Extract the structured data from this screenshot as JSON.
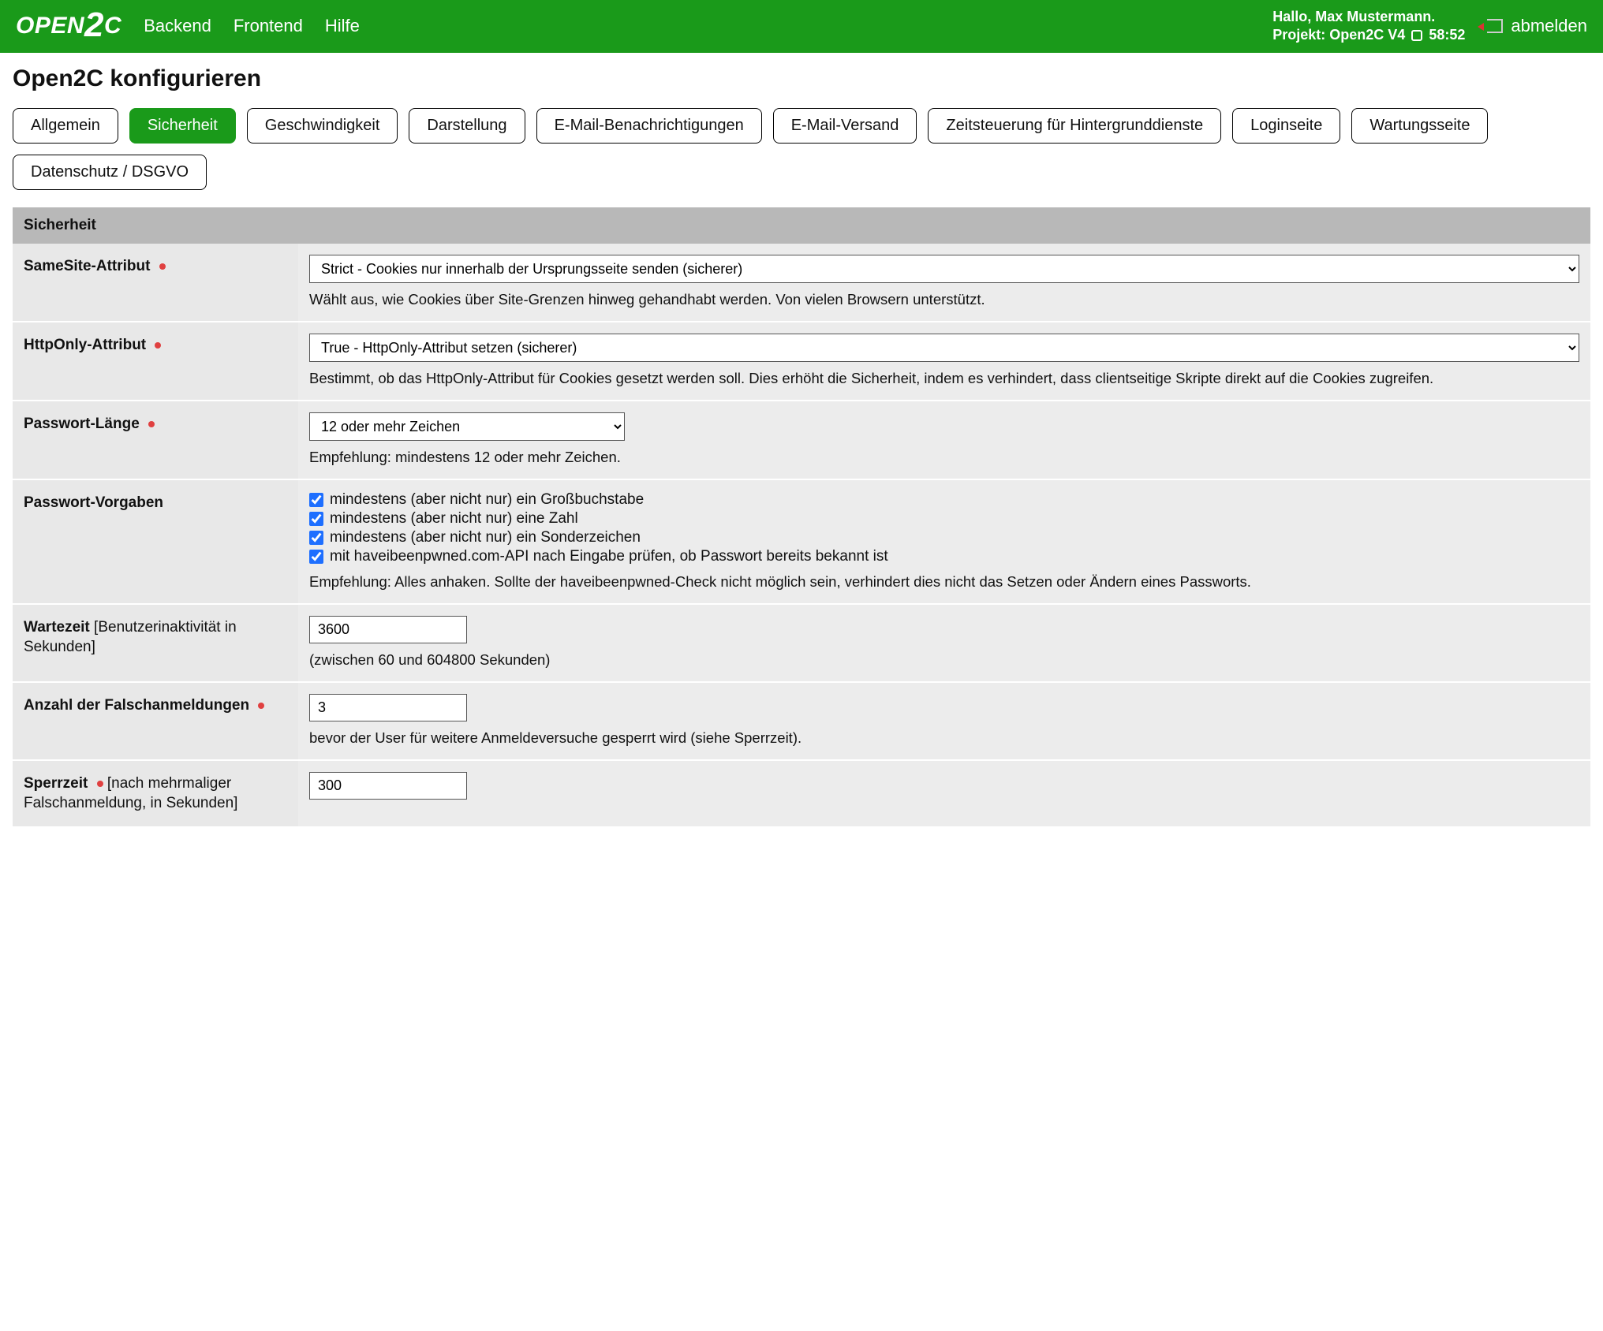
{
  "header": {
    "logo_prefix": "OPEN",
    "logo_big": "2",
    "logo_suffix": "C",
    "nav": [
      "Backend",
      "Frontend",
      "Hilfe"
    ],
    "greeting": "Hallo, Max Mustermann.",
    "project_label": "Projekt: Open2C V4",
    "timer": "58:52",
    "logout": "abmelden"
  },
  "page_title": "Open2C konfigurieren",
  "tabs": [
    {
      "label": "Allgemein",
      "active": false
    },
    {
      "label": "Sicherheit",
      "active": true
    },
    {
      "label": "Geschwindigkeit",
      "active": false
    },
    {
      "label": "Darstellung",
      "active": false
    },
    {
      "label": "E-Mail-Benachrichtigungen",
      "active": false
    },
    {
      "label": "E-Mail-Versand",
      "active": false
    },
    {
      "label": "Zeitsteuerung für Hintergrunddienste",
      "active": false
    },
    {
      "label": "Loginseite",
      "active": false
    },
    {
      "label": "Wartungsseite",
      "active": false
    },
    {
      "label": "Datenschutz / DSGVO",
      "active": false
    }
  ],
  "section_title": "Sicherheit",
  "rows": {
    "samesite": {
      "label": "SameSite-Attribut",
      "required": true,
      "value": "Strict - Cookies nur innerhalb der Ursprungsseite senden (sicherer)",
      "help": "Wählt aus, wie Cookies über Site-Grenzen hinweg gehandhabt werden. Von vielen Browsern unterstützt."
    },
    "httponly": {
      "label": "HttpOnly-Attribut",
      "required": true,
      "value": "True - HttpOnly-Attribut setzen (sicherer)",
      "help": "Bestimmt, ob das HttpOnly-Attribut für Cookies gesetzt werden soll. Dies erhöht die Sicherheit, indem es verhindert, dass clientseitige Skripte direkt auf die Cookies zugreifen."
    },
    "pwlen": {
      "label": "Passwort-Länge",
      "required": true,
      "value": "12 oder mehr Zeichen",
      "help": "Empfehlung: mindestens 12 oder mehr Zeichen."
    },
    "pwrules": {
      "label": "Passwort-Vorgaben",
      "required": false,
      "options": [
        "mindestens (aber nicht nur) ein Großbuchstabe",
        "mindestens (aber nicht nur) eine Zahl",
        "mindestens (aber nicht nur) ein Sonderzeichen",
        "mit haveibeenpwned.com-API nach Eingabe prüfen, ob Passwort bereits bekannt ist"
      ],
      "help": "Empfehlung: Alles anhaken. Sollte der haveibeenpwned-Check nicht möglich sein, verhindert dies nicht das Setzen oder Ändern eines Passworts."
    },
    "wait": {
      "label": "Wartezeit",
      "label_suffix": " [Benutzerinaktivität in Sekunden]",
      "required": false,
      "value": "3600",
      "help": "(zwischen 60 und 604800 Sekunden)"
    },
    "fails": {
      "label": "Anzahl der Falschanmeldungen",
      "required": true,
      "value": "3",
      "help": "bevor der User für weitere Anmeldeversuche gesperrt wird (siehe Sperrzeit)."
    },
    "lock": {
      "label": "Sperrzeit",
      "label_suffix": " [nach mehrmaliger Falschanmeldung, in Sekunden]",
      "required": true,
      "value": "300"
    }
  }
}
